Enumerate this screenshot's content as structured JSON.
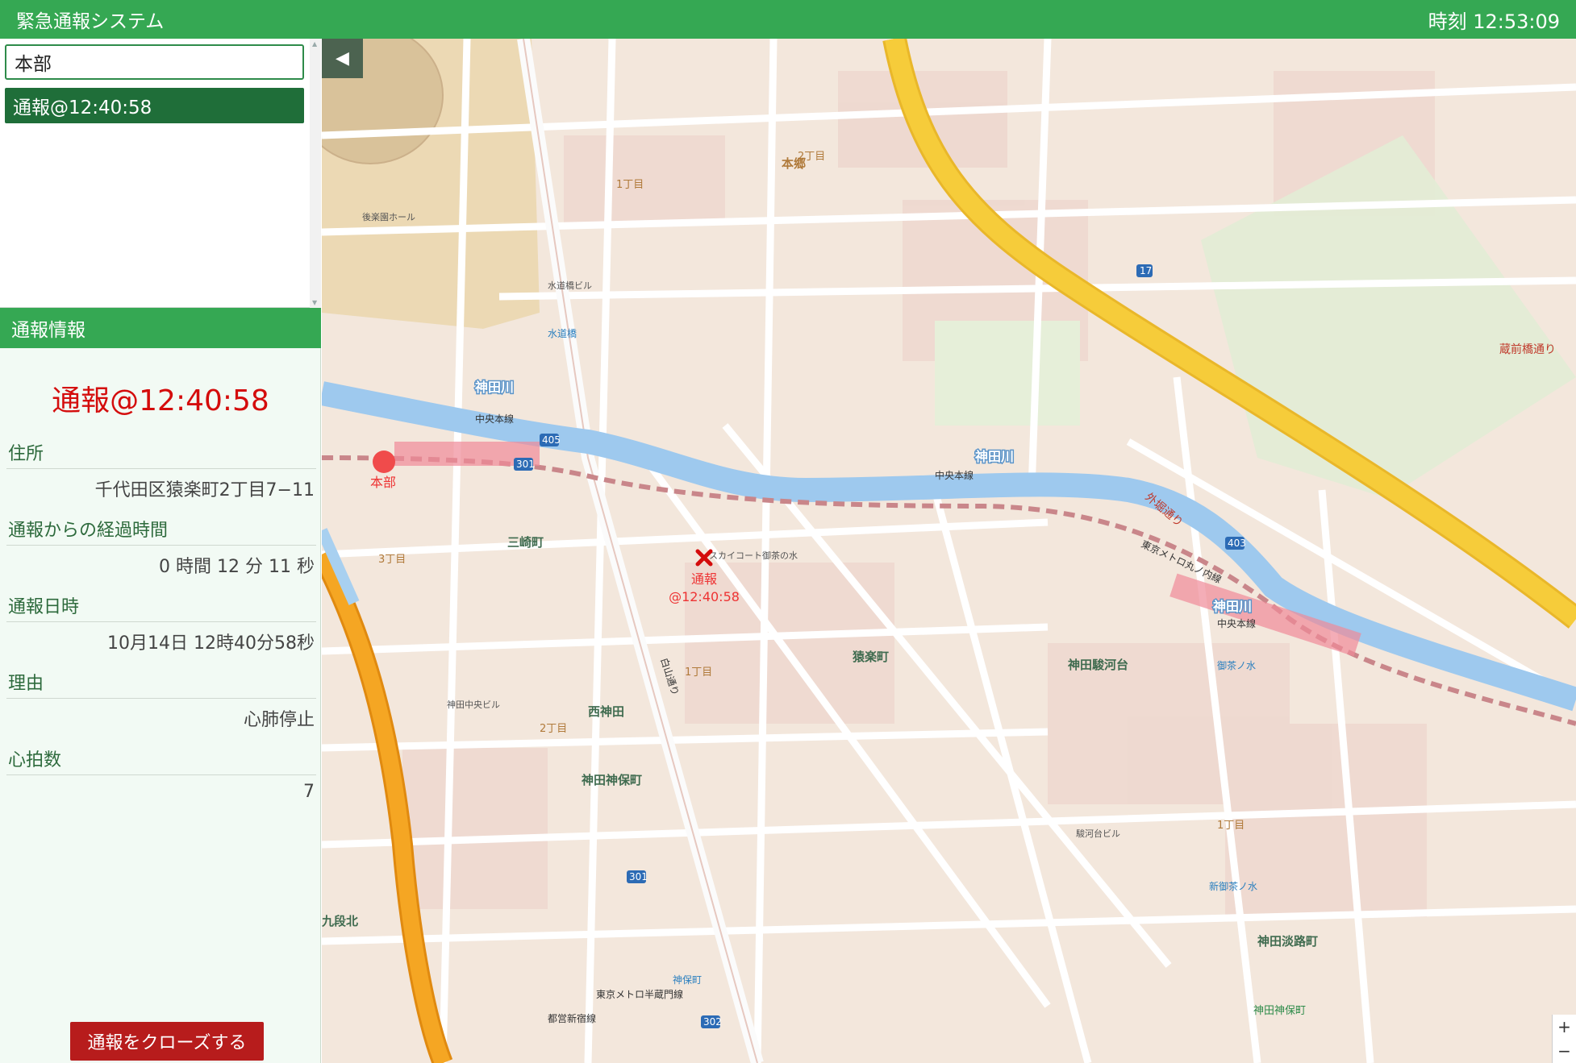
{
  "header": {
    "title": "緊急通報システム",
    "clock_label": "時刻",
    "clock_value": "12:53:09"
  },
  "sidebar": {
    "search_value": "本部",
    "calls": [
      {
        "label": "通報@12:40:58"
      }
    ],
    "info_header": "通報情報",
    "selected_title": "通報@12:40:58",
    "fields": {
      "address": {
        "label": "住所",
        "value": "千代田区猿楽町2丁目7−11"
      },
      "elapsed": {
        "label": "通報からの経過時間",
        "value": "0 時間 12 分 11 秒"
      },
      "datetime": {
        "label": "通報日時",
        "value": "10月14日 12時40分58秒"
      },
      "reason": {
        "label": "理由",
        "value": "心肺停止"
      },
      "heart_rate": {
        "label": "心拍数",
        "value": "7"
      }
    },
    "close_button": "通報をクローズする"
  },
  "map": {
    "hq_marker_label": "本部",
    "call_marker_label_1": "通報",
    "call_marker_label_2": "@12:40:58",
    "river_label_1": "神田川",
    "river_label_2": "神田川",
    "river_label_3": "神田川",
    "rail_label_1": "中央本線",
    "rail_label_2": "中央本線",
    "rail_label_3": "中央本線",
    "areas": {
      "misakicho": "三崎町",
      "nishikanda": "西神田",
      "kanda_jimbocho": "神田神保町",
      "sarugakucho": "猿楽町",
      "hongo": "本郷",
      "kanda_surugadai": "神田駿河台",
      "kudankita": "九段北",
      "kanda_awajicho": "神田淡路町"
    },
    "labels": {
      "suidobashi": "水道橋",
      "ochanomizu": "御茶ノ水",
      "jimbocho": "神保町",
      "shin_ochanomizu": "新御茶ノ水",
      "hakusan_dori": "白山通り",
      "sotobori_dori": "外堀通り",
      "kuramaebashi_dori": "蔵前橋通り",
      "toshin_shinjuku": "都営新宿線",
      "hanzomon": "東京メトロ半蔵門線",
      "marunouchi": "東京メトロ丸ノ内線",
      "kanda_jimbocho_sign": "神田神保町",
      "route301": "301",
      "route17": "17",
      "route405": "405",
      "route302": "302",
      "route403": "403",
      "chome1": "1丁目",
      "chome2": "2丁目",
      "chome3": "3丁目",
      "bldg1": "スカイコート御茶の水",
      "bldg2": "後楽園ホール",
      "bldg3": "水道橋ビル",
      "bldg4": "神田中央ビル",
      "bldg5": "駿河台ビル"
    },
    "zoom_in": "+",
    "zoom_out": "−",
    "collapse_icon": "◀"
  },
  "colors": {
    "header_bg": "#35a853",
    "selected_item_bg": "#1f6e39",
    "alert_red": "#d40c0c",
    "close_btn_bg": "#b71c1c",
    "river": "#a8d0f0",
    "highway": "#f5a623",
    "expressway_yellow": "#f6cc3a"
  }
}
